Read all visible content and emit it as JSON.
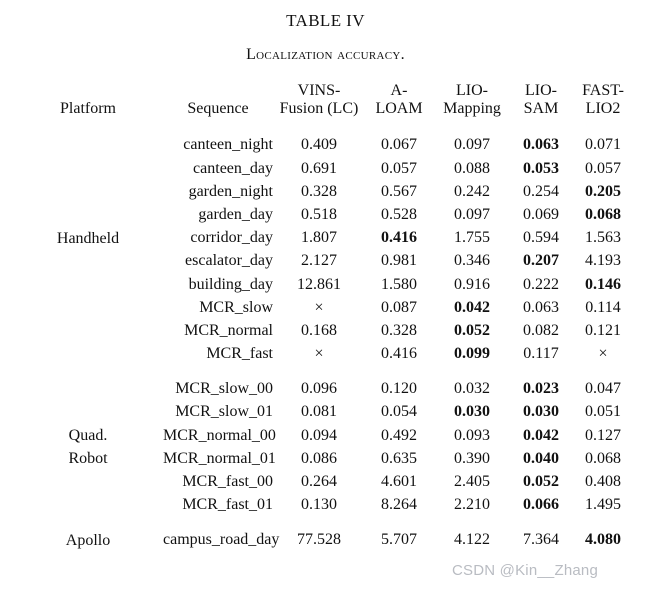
{
  "caption": {
    "label": "TABLE IV",
    "title": "Localization accuracy."
  },
  "watermark": "CSDN @Kin__Zhang",
  "table": {
    "columns": [
      {
        "key": "platform",
        "label": "Platform",
        "line1": "Platform",
        "line2": ""
      },
      {
        "key": "sequence",
        "label": "Sequence",
        "line1": "Sequence",
        "line2": ""
      },
      {
        "key": "vins",
        "label": "VINS-Fusion (LC)",
        "line1": "VINS-",
        "line2": "Fusion (LC)"
      },
      {
        "key": "aloam",
        "label": "A-LOAM",
        "line1": "A-",
        "line2": "LOAM"
      },
      {
        "key": "liomapping",
        "label": "LIO-Mapping",
        "line1": "LIO-",
        "line2": "Mapping"
      },
      {
        "key": "liosam",
        "label": "LIO-SAM",
        "line1": "LIO-",
        "line2": "SAM"
      },
      {
        "key": "fastlio2",
        "label": "FAST-LIO2",
        "line1": "FAST-",
        "line2": "LIO2"
      }
    ],
    "groups": [
      {
        "platform": "Handheld",
        "platform_lines": [
          "Handheld"
        ],
        "rows": [
          {
            "sequence": "canteen_night",
            "values": [
              "0.409",
              "0.067",
              "0.097",
              "0.063",
              "0.071"
            ],
            "bold": [
              false,
              false,
              false,
              true,
              false
            ]
          },
          {
            "sequence": "canteen_day",
            "values": [
              "0.691",
              "0.057",
              "0.088",
              "0.053",
              "0.057"
            ],
            "bold": [
              false,
              false,
              false,
              true,
              false
            ]
          },
          {
            "sequence": "garden_night",
            "values": [
              "0.328",
              "0.567",
              "0.242",
              "0.254",
              "0.205"
            ],
            "bold": [
              false,
              false,
              false,
              false,
              true
            ]
          },
          {
            "sequence": "garden_day",
            "values": [
              "0.518",
              "0.528",
              "0.097",
              "0.069",
              "0.068"
            ],
            "bold": [
              false,
              false,
              false,
              false,
              true
            ]
          },
          {
            "sequence": "corridor_day",
            "values": [
              "1.807",
              "0.416",
              "1.755",
              "0.594",
              "1.563"
            ],
            "bold": [
              false,
              true,
              false,
              false,
              false
            ]
          },
          {
            "sequence": "escalator_day",
            "values": [
              "2.127",
              "0.981",
              "0.346",
              "0.207",
              "4.193"
            ],
            "bold": [
              false,
              false,
              false,
              true,
              false
            ]
          },
          {
            "sequence": "building_day",
            "values": [
              "12.861",
              "1.580",
              "0.916",
              "0.222",
              "0.146"
            ],
            "bold": [
              false,
              false,
              false,
              false,
              true
            ]
          },
          {
            "sequence": "MCR_slow",
            "values": [
              "×",
              "0.087",
              "0.042",
              "0.063",
              "0.114"
            ],
            "bold": [
              false,
              false,
              true,
              false,
              false
            ]
          },
          {
            "sequence": "MCR_normal",
            "values": [
              "0.168",
              "0.328",
              "0.052",
              "0.082",
              "0.121"
            ],
            "bold": [
              false,
              false,
              true,
              false,
              false
            ]
          },
          {
            "sequence": "MCR_fast",
            "values": [
              "×",
              "0.416",
              "0.099",
              "0.117",
              "×"
            ],
            "bold": [
              false,
              false,
              true,
              false,
              false
            ]
          }
        ]
      },
      {
        "platform": "Quad. Robot",
        "platform_lines": [
          "Quad.",
          "Robot"
        ],
        "rows": [
          {
            "sequence": "MCR_slow_00",
            "values": [
              "0.096",
              "0.120",
              "0.032",
              "0.023",
              "0.047"
            ],
            "bold": [
              false,
              false,
              false,
              true,
              false
            ]
          },
          {
            "sequence": "MCR_slow_01",
            "values": [
              "0.081",
              "0.054",
              "0.030",
              "0.030",
              "0.051"
            ],
            "bold": [
              false,
              false,
              true,
              true,
              false
            ]
          },
          {
            "sequence": "MCR_normal_00",
            "values": [
              "0.094",
              "0.492",
              "0.093",
              "0.042",
              "0.127"
            ],
            "bold": [
              false,
              false,
              false,
              true,
              false
            ]
          },
          {
            "sequence": "MCR_normal_01",
            "values": [
              "0.086",
              "0.635",
              "0.390",
              "0.040",
              "0.068"
            ],
            "bold": [
              false,
              false,
              false,
              true,
              false
            ]
          },
          {
            "sequence": "MCR_fast_00",
            "values": [
              "0.264",
              "4.601",
              "2.405",
              "0.052",
              "0.408"
            ],
            "bold": [
              false,
              false,
              false,
              true,
              false
            ]
          },
          {
            "sequence": "MCR_fast_01",
            "values": [
              "0.130",
              "8.264",
              "2.210",
              "0.066",
              "1.495"
            ],
            "bold": [
              false,
              false,
              false,
              true,
              false
            ]
          }
        ]
      },
      {
        "platform": "Apollo",
        "platform_lines": [
          "Apollo"
        ],
        "rows": [
          {
            "sequence": "campus_road_day",
            "values": [
              "77.528",
              "5.707",
              "4.122",
              "7.364",
              "4.080"
            ],
            "bold": [
              false,
              false,
              false,
              false,
              true
            ]
          }
        ]
      }
    ]
  }
}
